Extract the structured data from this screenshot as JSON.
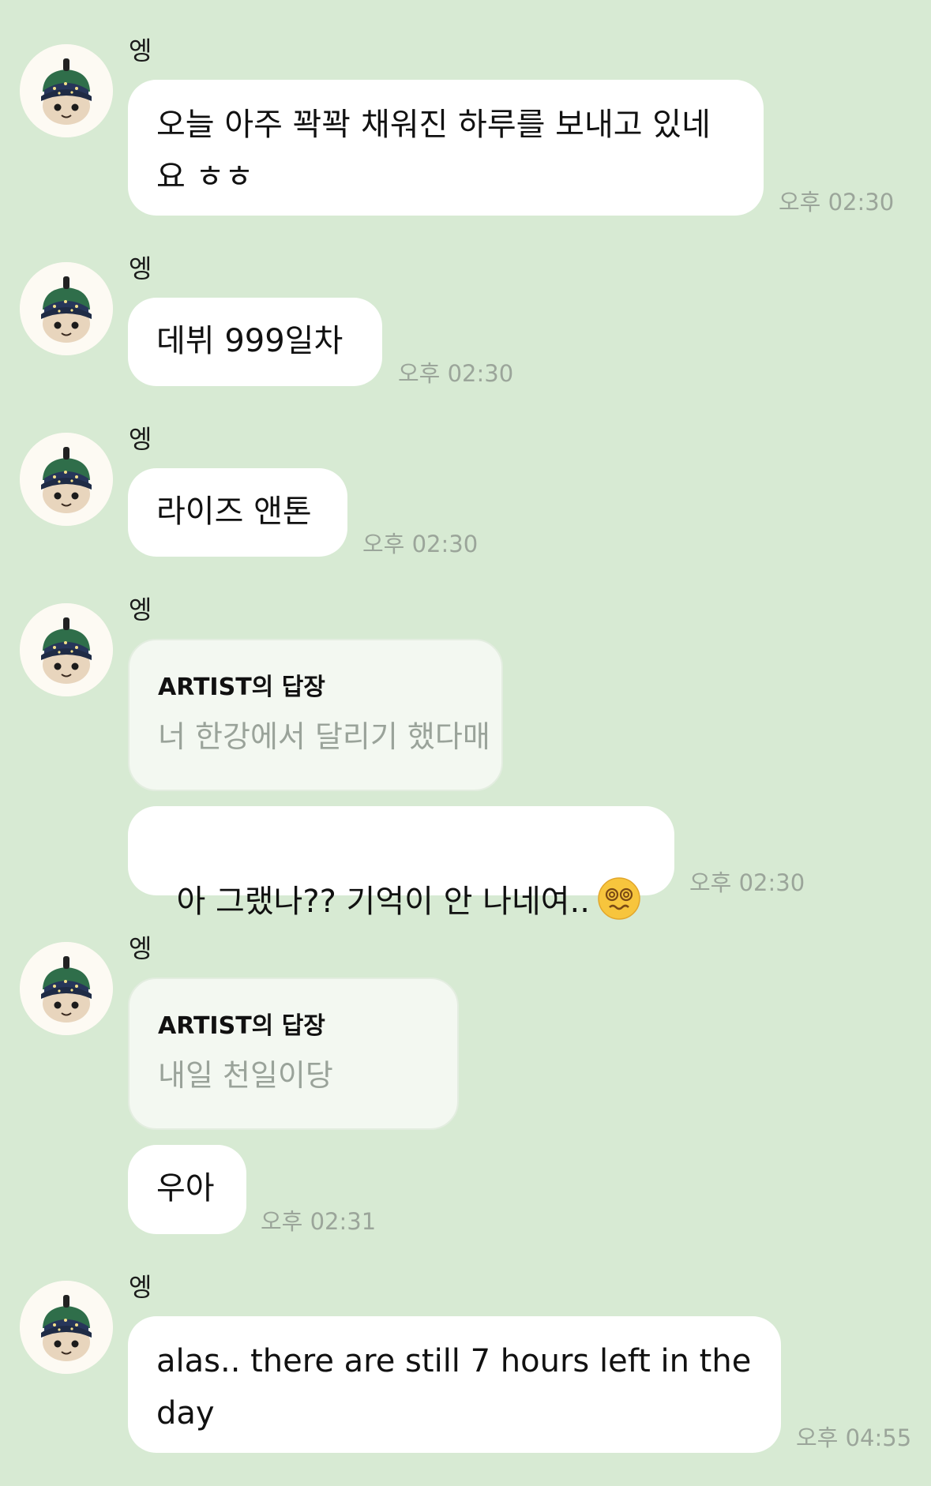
{
  "chat": {
    "messages": [
      {
        "sender": "엥",
        "text": "오늘 아주 꽉꽉 채워진 하루를 보내고 있네\n요 ㅎㅎ",
        "time": "오후 02:30"
      },
      {
        "sender": "엥",
        "text": "데뷔 999일차",
        "time": "오후 02:30"
      },
      {
        "sender": "엥",
        "text": "라이즈 앤톤",
        "time": "오후 02:30"
      },
      {
        "sender": "엥",
        "reply_title": "ARTIST의 답장",
        "reply_text": "너 한강에서 달리기 했다매",
        "text": "아 그랬나?? 기억이 안 나네여..",
        "emoji": "dizzy-face-emoji",
        "time": "오후 02:30"
      },
      {
        "sender": "엥",
        "reply_title": "ARTIST의 답장",
        "reply_text": "내일 천일이당",
        "text": "우아",
        "time": "오후 02:31"
      },
      {
        "sender": "엥",
        "text": "alas.. there are still 7 hours left in the\nday",
        "time": "오후 04:55"
      }
    ]
  },
  "colors": {
    "background": "#d7ead3",
    "bubble": "#ffffff",
    "reply_bubble": "#f3f8f1",
    "timestamp": "#9ba59a"
  }
}
